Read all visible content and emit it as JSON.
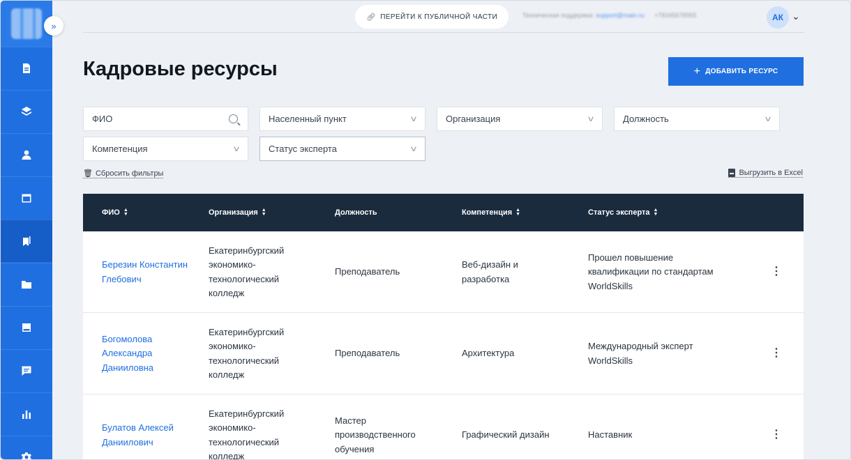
{
  "topbar": {
    "public_link": "ПЕРЕЙТИ К ПУБЛИЧНОЙ ЧАСТИ",
    "support_label": "Техническая поддержка:",
    "support_email": "support@main.ru",
    "support_phone": "+78345678955",
    "avatar_initials": "АК"
  },
  "page": {
    "title": "Кадровые ресурсы",
    "add_button": "ДОБАВИТЬ РЕСУРС"
  },
  "filters": {
    "fio": "ФИО",
    "city": "Населенный пункт",
    "organization": "Организация",
    "position": "Должность",
    "competence": "Компетенция",
    "expert_status": "Статус эксперта"
  },
  "actions": {
    "reset": "Сбросить фильтры",
    "export": "Выгрузить в Excel"
  },
  "table": {
    "headers": {
      "fio": "ФИО",
      "organization": "Организация",
      "position": "Должность",
      "competence": "Компетенция",
      "status": "Статус эксперта"
    },
    "rows": [
      {
        "fio": "Березин Константин Глебович",
        "organization": "Екатеринбургский экономико-технологический колледж",
        "position": "Преподаватель",
        "competence": "Веб-дизайн и разработка",
        "status": "Прошел повышение квалификации по стандартам WorldSkills"
      },
      {
        "fio": "Богомолова Александра Данииловна",
        "organization": "Екатеринбургский экономико-технологический колледж",
        "position": "Преподаватель",
        "competence": "Архитектура",
        "status": "Международный эксперт WorldSkills"
      },
      {
        "fio": "Булатов Алексей Даниилович",
        "organization": "Екатеринбургский экономико-технологический колледж",
        "position": "Мастер производственного обучения",
        "competence": "Графический дизайн",
        "status": "Наставник"
      }
    ]
  },
  "icons": {
    "link": "link-icon",
    "search": "search-icon",
    "chevron": "chevron-down-icon",
    "trash": "trash-icon",
    "excel": "file-icon",
    "more": "more-vertical-icon"
  },
  "colors": {
    "accent": "#1f6fe0",
    "sidebar": "#1f6fe0",
    "table_header": "#1b2b3e",
    "background": "#edf0f5"
  }
}
